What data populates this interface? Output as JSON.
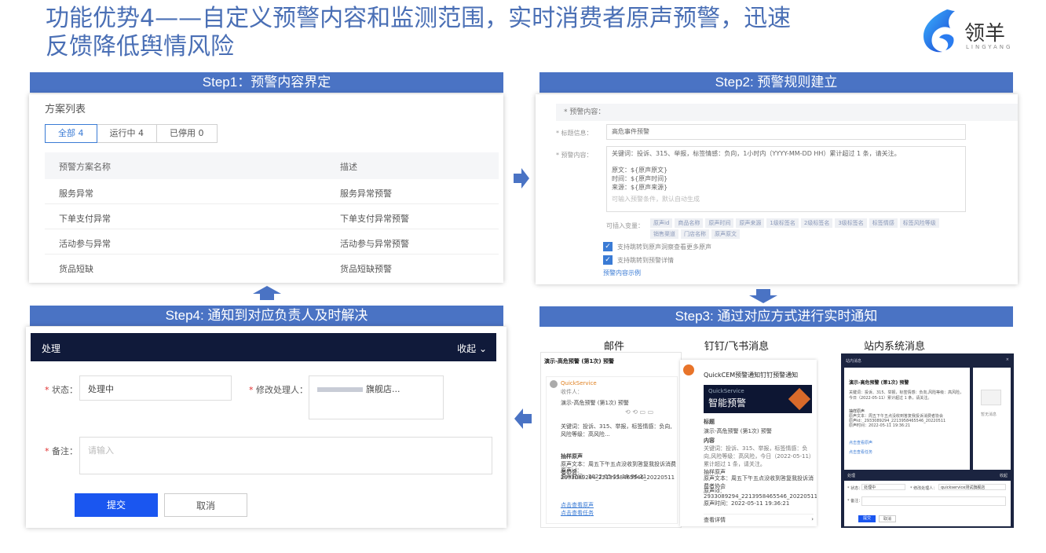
{
  "slide": {
    "title": "功能优势4——自定义预警内容和监测范围，实时消费者原声预警，迅速反馈降低舆情风险"
  },
  "logo": {
    "name": "领羊",
    "sub": "LINGYANG"
  },
  "steps": {
    "s1": "Step1：预警内容界定",
    "s2": "Step2: 预警规则建立",
    "s3": "Step3: 通过对应方式进行实时通知",
    "s4": "Step4: 通知到对应负责人及时解决"
  },
  "step1": {
    "caption": "方案列表",
    "tabs": [
      {
        "label": "全部  4"
      },
      {
        "label": "运行中  4"
      },
      {
        "label": "已停用  0"
      }
    ],
    "columns": [
      "预警方案名称",
      "描述"
    ],
    "rows": [
      [
        "服务异常",
        "服务异常预警"
      ],
      [
        "下单支付异常",
        "下单支付异常预警"
      ],
      [
        "活动参与异常",
        "活动参与异常预警"
      ],
      [
        "货品短缺",
        "货品短缺预警"
      ]
    ]
  },
  "step2": {
    "section": "* 预警内容：",
    "title_label": "* 标题信息：",
    "title_value": "高危事件预警",
    "content_label": "* 预警内容：",
    "content_lines": [
      "关键词：投诉、315、举报，标签情感：负向，1小时内（YYYY-MM-DD HH）累计超过 1 条，请关注。",
      "",
      "原文：${原声原文}",
      "时间：${原声时间}",
      "来源：${原声来源}",
      "可输入预警条件，默认自动生成"
    ],
    "vars_label": "可插入变量：",
    "chips": [
      "原声id",
      "商品名称",
      "原声时间",
      "原声来源",
      "1级标签名",
      "2级标签名",
      "3级标签名",
      "标签情感",
      "标签风险等级",
      "销售渠道",
      "门店名称",
      "原声原文"
    ],
    "check1": "支持跳转到原声洞察查看更多原声",
    "check2": "支持跳转到预警详情",
    "link": "预警内容示例"
  },
  "step3": {
    "labels": [
      "邮件",
      "钉钉/飞书消息",
      "站内系统消息"
    ],
    "email": {
      "subject": "演示-高危预警 (第1次) 预警",
      "sender": "QuickService",
      "receiver": "收件人：",
      "body_title": "演示-高危预警 (第1次) 预警",
      "keywords": "关键词：投诉、315、举报，标签情感：负向,风险等级：高风险...",
      "sample_title": "抽样原声",
      "sample_text": "原声文本：周五下午五点没收到答复我投诉消费者协会",
      "sample_id": "原声id：2933089294_2213958465546_20220511",
      "sample_time": "原声时间：2022-05-11 19:36:21",
      "link1": "点击查看原声",
      "link2": "点击查看任务"
    },
    "dingtalk": {
      "header": "QuickCEM预警通知钉钉预警通知",
      "banner_small": "QuickService",
      "banner_big": "智能预警",
      "title_label": "标题",
      "title_value": "演示-高危预警 (第1次) 预警",
      "content_label": "内容",
      "content_text": "关键词：投诉、315、举报，标签情感：负向,风险等级：高风险，今日（2022-05-11）累计超过 1 条，请关注。",
      "sample_title": "抽样原声",
      "sample_text": "原声文本：周五下午五点没收到答复我投诉消费者协会",
      "sample_id_label": "原声id：",
      "sample_id": "2933089294_2213958465546_20220511",
      "sample_time": "原声时间：2022-05-11 19:36:21",
      "more": "查看详情"
    },
    "system": {
      "header": "站内消息",
      "title": "演示-高危预警 (第1次) 预警",
      "keywords": "关键词：投诉、315、举报，标签情感：负向,风险等级：高风险，今日（2022-05-11）累计超过 1 条，请关注。",
      "sample_title": "抽样原声",
      "sample_text": "原声文本：周五下午五点没收到答复我投诉消费者协会",
      "sample_id": "原声id：2933089294_2213958465546_20220511",
      "sample_time": "原声时间：2022-05-11 19:36:21",
      "link1": "点击查看原声",
      "link2": "点击查看任务",
      "side_label": "暂无消息",
      "panel_title": "处理",
      "panel_collapse": "收起",
      "status_label": "* 状态：",
      "status_value": "处理中",
      "handler_label": "* 修改处理人：",
      "handler_value": "quickservice测试旗舰店",
      "remark_label": "* 备注：",
      "submit": "提交",
      "cancel": "取消"
    }
  },
  "step4": {
    "header": "处理",
    "collapse": "收起",
    "status_label": "状态：",
    "status_value": "处理中",
    "handler_label": "修改处理人：",
    "handler_value": "旗舰店...",
    "remark_label": "备注：",
    "remark_placeholder": "请输入",
    "submit": "提交",
    "cancel": "取消"
  },
  "colors": {
    "step_bar": "#4a73c4",
    "title": "#4a6fb5",
    "primary": "#1a56f0",
    "dark_header": "#101a3a",
    "arrow": "#4a73c4"
  }
}
